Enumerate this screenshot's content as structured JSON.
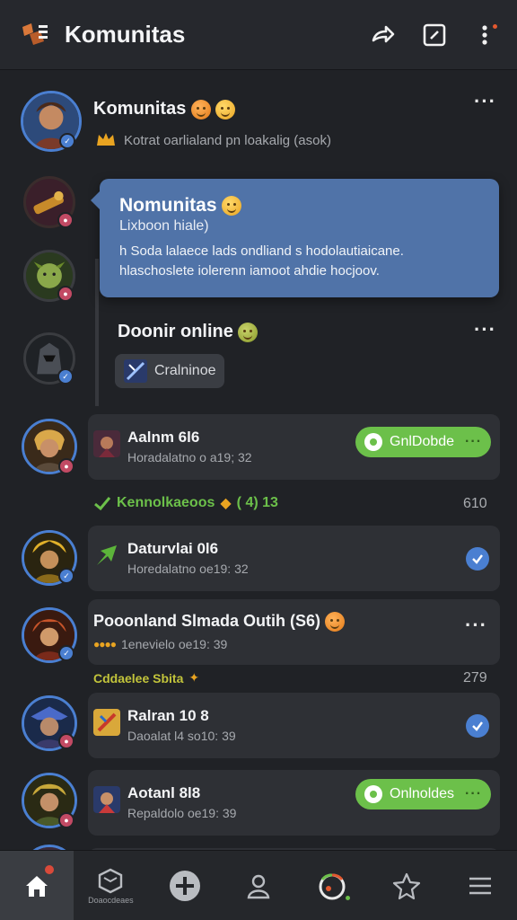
{
  "header": {
    "title": "Komunitas",
    "icons": [
      "logo-icon",
      "share-icon",
      "compose-icon",
      "more-vertical-icon"
    ]
  },
  "profile": {
    "name": "Komunitas",
    "subtitle": "Kotrat oarlialand pn loakalig (asok)"
  },
  "tooltip": {
    "title": "Nomunitas",
    "subtitle": "Lixboon hiale)",
    "line1": "h Soda lalaece lads ondliand s hodolautiaicane.",
    "line2": "hlaschoslete iolerenn iamoot ahdie hocjoov."
  },
  "online_section": {
    "title": "Doonir online",
    "chip_label": "Cralninoe"
  },
  "rows": [
    {
      "name": "Aalnm 6l6",
      "sub": "Horadalatno o a19; 32",
      "pill": "GnlDobde"
    },
    {
      "name": "Daturvlai 0l6",
      "sub": "Horedalatno oe19: 32"
    },
    {
      "name": "Pooonland Slmada Outih (S6)",
      "sub": "1enevielo oe19: 39"
    },
    {
      "name": "Ralran 10 8",
      "sub": "Daoalat l4 so10: 39"
    },
    {
      "name": "Aotanl 8l8",
      "sub": "Repaldolo oe19: 39",
      "pill": "Onlnoldes"
    }
  ],
  "sections": {
    "green_label": "Kennolkaeoos",
    "green_label_suffix": "( 4)  13",
    "green_count": "610",
    "yellow_label": "Cddaelee Sbita",
    "yellow_count": "279"
  },
  "bottom_nav": {
    "items": [
      "home",
      "communities",
      "add",
      "profile",
      "games",
      "favorites",
      "menu"
    ],
    "communities_label": "Doaocdeaes"
  }
}
